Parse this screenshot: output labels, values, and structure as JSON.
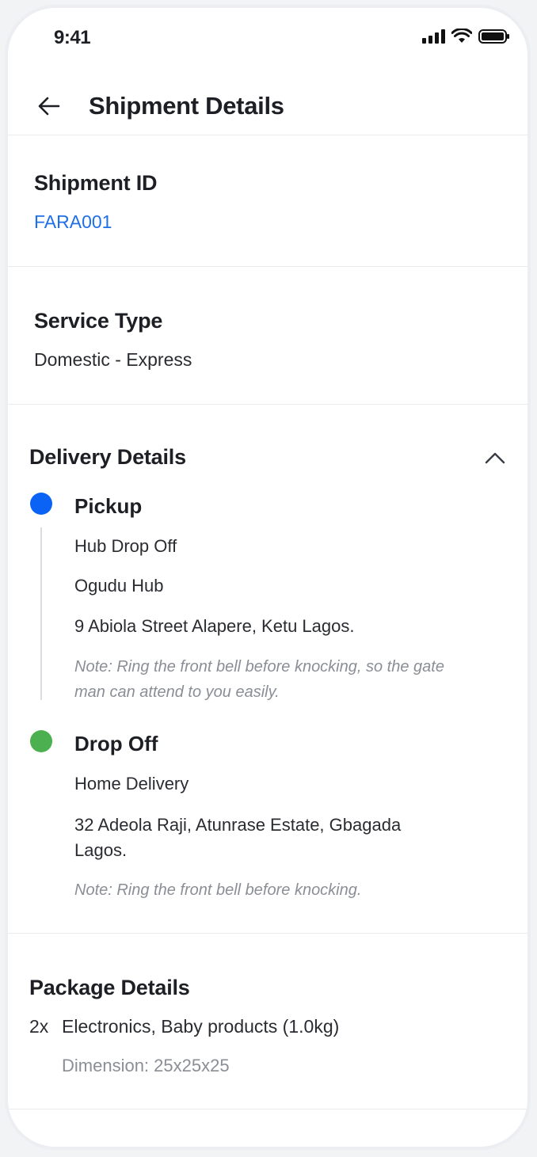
{
  "status_bar": {
    "time": "9:41"
  },
  "header": {
    "title": "Shipment Details"
  },
  "shipment": {
    "label": "Shipment  ID",
    "id": "FARA001"
  },
  "service": {
    "label": "Service Type",
    "value": "Domestic - Express"
  },
  "delivery": {
    "title": "Delivery Details",
    "pickup": {
      "title": "Pickup",
      "method": "Hub Drop Off",
      "hub": "Ogudu Hub",
      "address": "9 Abiola Street Alapere, Ketu Lagos.",
      "note_line1": "Note: Ring the front bell before knocking, so the gate",
      "note_line2": "man can attend to you easily.",
      "dot_color": "#0a63f5"
    },
    "dropoff": {
      "title": "Drop Off",
      "method": "Home Delivery",
      "address_line1": "32 Adeola Raji, Atunrase Estate, Gbagada",
      "address_line2": "Lagos.",
      "note": "Note: Ring the front bell before knocking.",
      "dot_color": "#4caf50"
    }
  },
  "package": {
    "title": "Package Details",
    "quantity": "2x",
    "items": "Electronics, Baby products (1.0kg)",
    "dimension": "Dimension: 25x25x25"
  },
  "icons": {
    "back": "arrow-left-icon",
    "chevron": "chevron-up-icon",
    "signal": "signal-icon",
    "wifi": "wifi-icon",
    "battery": "battery-icon"
  }
}
